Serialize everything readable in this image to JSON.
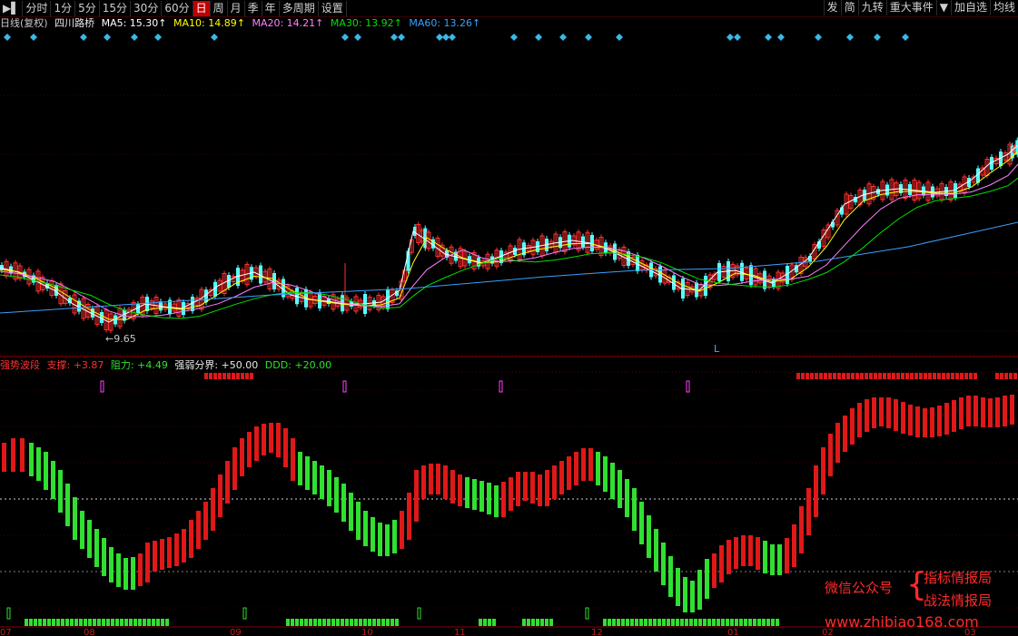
{
  "toolbar": {
    "periods": [
      "分时",
      "1分",
      "5分",
      "15分",
      "30分",
      "60分",
      "日",
      "周",
      "月",
      "季",
      "年",
      "多周期",
      "设置"
    ],
    "active_period": "日",
    "right_buttons": [
      "发",
      "简",
      "九转",
      "重大事件",
      "▼",
      "加自选",
      "均线"
    ]
  },
  "main_info": {
    "period_label": "日线(复权)",
    "stock_name": "四川路桥",
    "ma5": "MA5: 15.30↑",
    "ma10": "MA10: 14.89↑",
    "ma20": "MA20: 14.21↑",
    "ma30": "MA30: 13.92↑",
    "ma60": "MA60: 13.26↑"
  },
  "low_marker": "9.65",
  "l_marker": "L",
  "indicator_info": {
    "name": "强势波段",
    "support": "支撑: +3.87",
    "resistance": "阻力: +4.49",
    "boundary": "强弱分界: +50.00",
    "ddd": "DDD: +20.00"
  },
  "x_axis_labels": [
    "07",
    "08",
    "09",
    "10",
    "11",
    "12",
    "01",
    "02",
    "03"
  ],
  "watermark": {
    "left": "微信公众号",
    "line1": "指标情报局",
    "line2": "战法情报局",
    "url": "www.zhibiao168.com"
  },
  "colors": {
    "up": "#ff3030",
    "down": "#54ffff",
    "ma5": "#ffffff",
    "ma10": "#ffff00",
    "ma20": "#ff80ff",
    "ma30": "#00e000",
    "ma60": "#3aa0ff",
    "bar_red": "#e01818",
    "bar_green": "#30e030",
    "diamond": "#3ab8e8"
  }
}
